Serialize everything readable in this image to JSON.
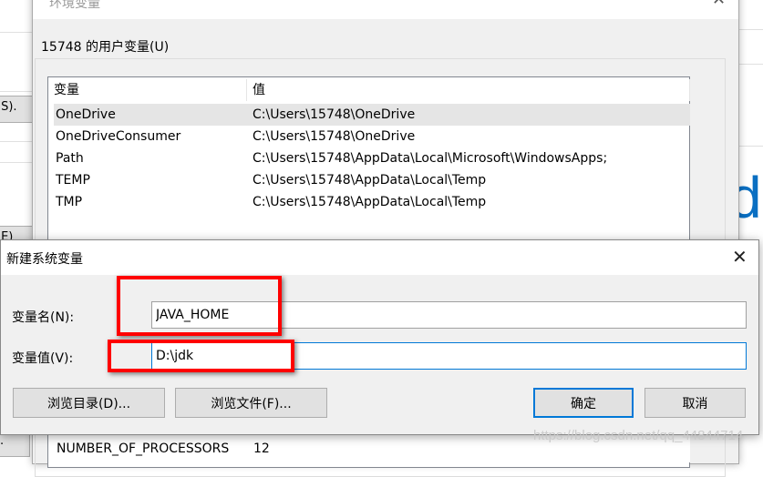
{
  "background_app": {
    "button_s_label": "(S).",
    "button_e_label": "(E)",
    "button_y_label": "y)...",
    "partial_logo_text": "d"
  },
  "env_window": {
    "title": "环境变量",
    "close_icon": "close-icon",
    "user_vars_group_label": "15748 的用户变量(U)",
    "columns": [
      "变量",
      "值"
    ],
    "rows": [
      {
        "name": "OneDrive",
        "value": "C:\\Users\\15748\\OneDrive",
        "selected": true
      },
      {
        "name": "OneDriveConsumer",
        "value": "C:\\Users\\15748\\OneDrive"
      },
      {
        "name": "Path",
        "value": "C:\\Users\\15748\\AppData\\Local\\Microsoft\\WindowsApps;"
      },
      {
        "name": "TEMP",
        "value": "C:\\Users\\15748\\AppData\\Local\\Temp"
      },
      {
        "name": "TMP",
        "value": "C:\\Users\\15748\\AppData\\Local\\Temp"
      }
    ],
    "system_row": {
      "name": "NUMBER_OF_PROCESSORS",
      "value": "12"
    }
  },
  "dialog": {
    "title": "新建系统变量",
    "close_icon": "close-icon",
    "name_label": "变量名(N):",
    "name_value": "JAVA_HOME",
    "value_label": "变量值(V):",
    "value_value": "D:\\jdk",
    "browse_dir_label": "浏览目录(D)...",
    "browse_file_label": "浏览文件(F)...",
    "ok_label": "确定",
    "cancel_label": "取消",
    "highlight_color": "#ff0000",
    "accent_color": "#0078d7"
  },
  "watermark": "https://blog.csdn.net/qq_44844714"
}
